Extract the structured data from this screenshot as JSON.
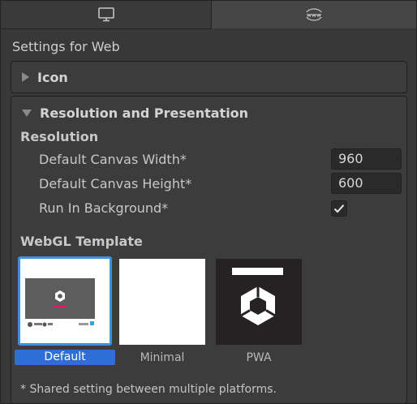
{
  "tabs": {
    "standalone_icon": "monitor-icon",
    "web_icon": "www-globe-icon",
    "web_icon_text": "www"
  },
  "settings_title": "Settings for Web",
  "icon_section": {
    "label": "Icon",
    "expanded": false
  },
  "resolution_section": {
    "label": "Resolution and Presentation",
    "expanded": true,
    "resolution_heading": "Resolution",
    "fields": {
      "width_label": "Default Canvas Width*",
      "width_value": "960",
      "height_label": "Default Canvas Height*",
      "height_value": "600",
      "background_label": "Run In Background*",
      "background_checked": true
    },
    "webgl_heading": "WebGL Template",
    "templates": [
      {
        "label": "Default",
        "selected": true
      },
      {
        "label": "Minimal",
        "selected": false
      },
      {
        "label": "PWA",
        "selected": false
      }
    ],
    "default_preview_brand": "Unity",
    "footnote": "* Shared setting between multiple platforms."
  },
  "colors": {
    "accent": "#3d8fe0",
    "selected_label_bg": "#2f6ed6",
    "panel_bg": "#3c3c3c",
    "field_bg": "#2a2a2a",
    "preview_pink": "#e6176b"
  }
}
